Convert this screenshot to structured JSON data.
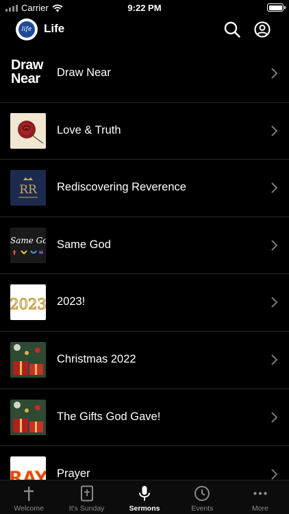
{
  "status_bar": {
    "carrier": "Carrier",
    "time": "9:22 PM"
  },
  "header": {
    "title": "Life",
    "logo_text": "life"
  },
  "sermons": [
    {
      "title": "Draw Near",
      "thumb_text": [
        "Draw",
        "Near"
      ]
    },
    {
      "title": "Love & Truth"
    },
    {
      "title": "Rediscovering Reverence",
      "thumb_text": "RR"
    },
    {
      "title": "Same God",
      "thumb_text": "Same God"
    },
    {
      "title": "2023!",
      "thumb_text": "2023"
    },
    {
      "title": "Christmas 2022"
    },
    {
      "title": "The Gifts God Gave!"
    },
    {
      "title": "Prayer",
      "thumb_text": "RAYE"
    }
  ],
  "tabs": [
    {
      "label": "Welcome",
      "icon": "cross-icon",
      "active": false
    },
    {
      "label": "It's Sunday",
      "icon": "bible-icon",
      "active": false
    },
    {
      "label": "Sermons",
      "icon": "microphone-icon",
      "active": true
    },
    {
      "label": "Events",
      "icon": "clock-icon",
      "active": false
    },
    {
      "label": "More",
      "icon": "ellipsis-icon",
      "active": false
    }
  ],
  "colors": {
    "background": "#000000",
    "inactive_tab": "#8b8b8b",
    "separator": "#2a2a2a",
    "logo_blue": "#1f4a96"
  }
}
